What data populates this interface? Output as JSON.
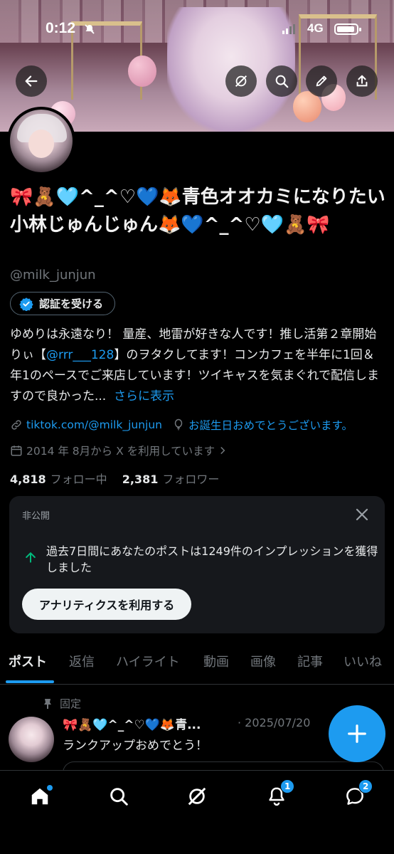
{
  "status_bar": {
    "time": "0:12",
    "network": "4G"
  },
  "profile": {
    "display_name": "🎀🧸🩵^_^♡💙🦊青色オオカミになりたい小林じゅんじゅん🦊💙^_^♡🩵🧸🎀",
    "handle": "@milk_junjun",
    "verify_button": "認証を受ける",
    "bio_parts": {
      "p1": "ゆめりは永遠なり！ 量産、地雷が好きな人です！推し活第２章開始りぃ【",
      "mention": "@rrr___128",
      "p2": "】のヲタクしてます！コンカフェを半年に1回＆年1のペースでご来店しています！ツイキャスを気まぐれで配信しますので良かった...",
      "more": "さらに表示"
    },
    "link": "tiktok.com/@milk_junjun",
    "birthday": "お誕生日おめでとうございます。",
    "joined": "2014 年 8月から X を利用しています",
    "following_count": "4,818",
    "following_label": "フォロー中",
    "followers_count": "2,381",
    "followers_label": "フォロワー"
  },
  "private_card": {
    "label": "非公開",
    "message": "過去7日間にあなたのポストは1249件のインプレッションを獲得しました",
    "button": "アナリティクスを利用する"
  },
  "tabs": [
    "ポスト",
    "返信",
    "ハイライト",
    "動画",
    "画像",
    "記事",
    "いいね"
  ],
  "pinned_post": {
    "pin_label": "固定",
    "author": "🎀🧸🩵^_^♡💙🦊青...",
    "date": "· 2025/07/20",
    "text": "ランクアップおめでとう！"
  },
  "bottom_nav": {
    "notifications_badge": "1",
    "messages_badge": "2"
  },
  "colors": {
    "accent": "#1d9bf0",
    "background": "#000000",
    "card": "#16181c",
    "muted": "#71767b"
  },
  "icons": [
    "back-arrow-icon",
    "grok-icon",
    "search-icon",
    "edit-pencil-icon",
    "share-icon",
    "verified-badge-icon",
    "link-icon",
    "balloon-icon",
    "calendar-icon",
    "chevron-right-icon",
    "close-icon",
    "arrow-up-icon",
    "pin-icon",
    "plus-icon",
    "home-icon",
    "bell-icon",
    "messages-icon"
  ]
}
